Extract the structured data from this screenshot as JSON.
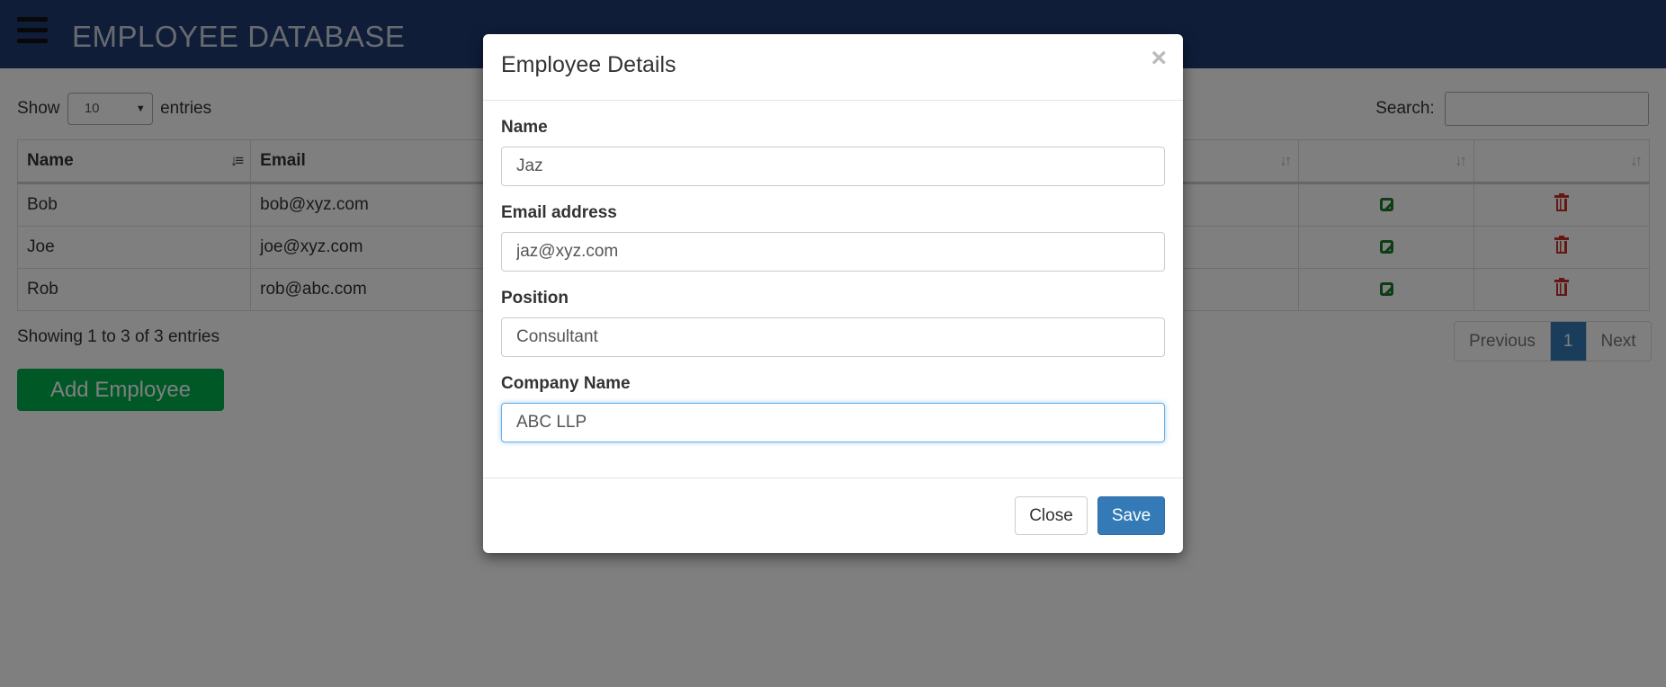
{
  "navbar": {
    "title": "EMPLOYEE DATABASE",
    "menu_icon": "hamburger-icon"
  },
  "table_controls": {
    "show_label": "Show",
    "page_length": "10",
    "entries_label": "entries",
    "search_label": "Search:",
    "search_value": ""
  },
  "table": {
    "columns": [
      "Name",
      "Email",
      "",
      "",
      ""
    ],
    "rows": [
      {
        "name": "Bob",
        "email": "bob@xyz.com"
      },
      {
        "name": "Joe",
        "email": "joe@xyz.com"
      },
      {
        "name": "Rob",
        "email": "rob@abc.com"
      }
    ],
    "edit_icon": "edit-icon",
    "delete_icon": "trash-icon",
    "accent_edit": "#1a7a28",
    "accent_delete": "#c9302c"
  },
  "footer": {
    "info": "Showing 1 to 3 of 3 entries",
    "pagination": {
      "previous": "Previous",
      "current": "1",
      "next": "Next"
    },
    "add_button": "Add Employee"
  },
  "modal": {
    "title": "Employee Details",
    "close_symbol": "×",
    "fields": {
      "name": {
        "label": "Name",
        "value": "Jaz"
      },
      "email": {
        "label": "Email address",
        "value": "jaz@xyz.com"
      },
      "position": {
        "label": "Position",
        "value": "Consultant"
      },
      "company": {
        "label": "Company Name",
        "value": "ABC LLP"
      }
    },
    "close_button": "Close",
    "save_button": "Save"
  },
  "colors": {
    "navbar": "#1f3b73",
    "add_button": "#00b14f",
    "primary": "#337ab7"
  }
}
